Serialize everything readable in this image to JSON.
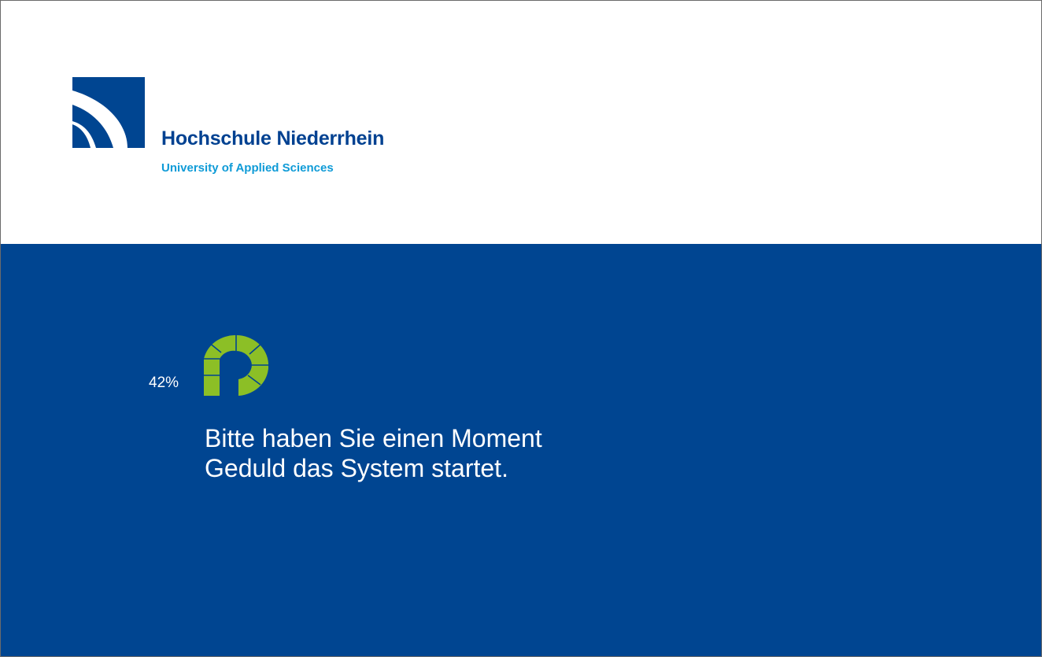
{
  "header": {
    "logo_name": "Hochschule Niederrhein",
    "logo_subtitle": "University of Applied Sciences",
    "logo_icon": "hochschule-niederrhein-logo-icon"
  },
  "loading": {
    "progress_text": "42%",
    "progress_value": 0.42,
    "spinner_icon": "loading-spinner-icon",
    "message_line1": "Bitte haben Sie einen Moment",
    "message_line2": "Geduld das System startet."
  },
  "colors": {
    "brand_blue": "#004591",
    "brand_light_blue": "#0f9bd7",
    "spinner_green": "#8cbf26",
    "header_background": "#ffffff"
  }
}
